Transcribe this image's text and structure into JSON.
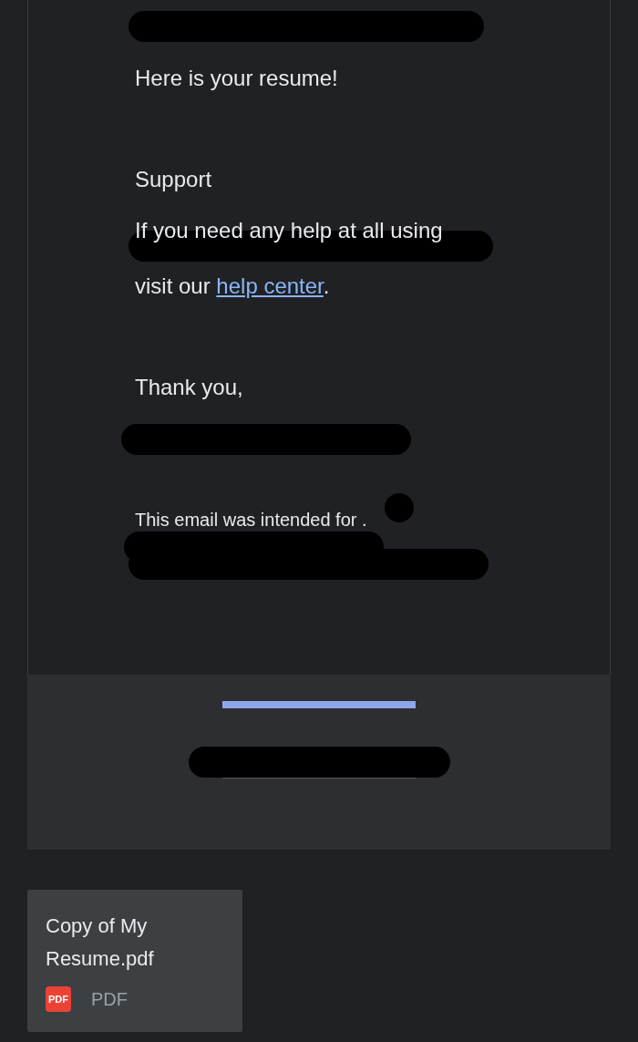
{
  "email": {
    "greeting": "Here is your resume!",
    "support_heading": "Support",
    "help_line": "If you need any help at all using",
    "help_prefix": "visit our",
    "help_link": "help center",
    "help_suffix": ".",
    "sign_off": "Thank you,",
    "intended_for": "This email was intended for ."
  },
  "attachment": {
    "name_lines": [
      "Copy of My",
      "Resume.pdf"
    ],
    "type_badge": "PDF",
    "type_label": "PDF"
  }
}
